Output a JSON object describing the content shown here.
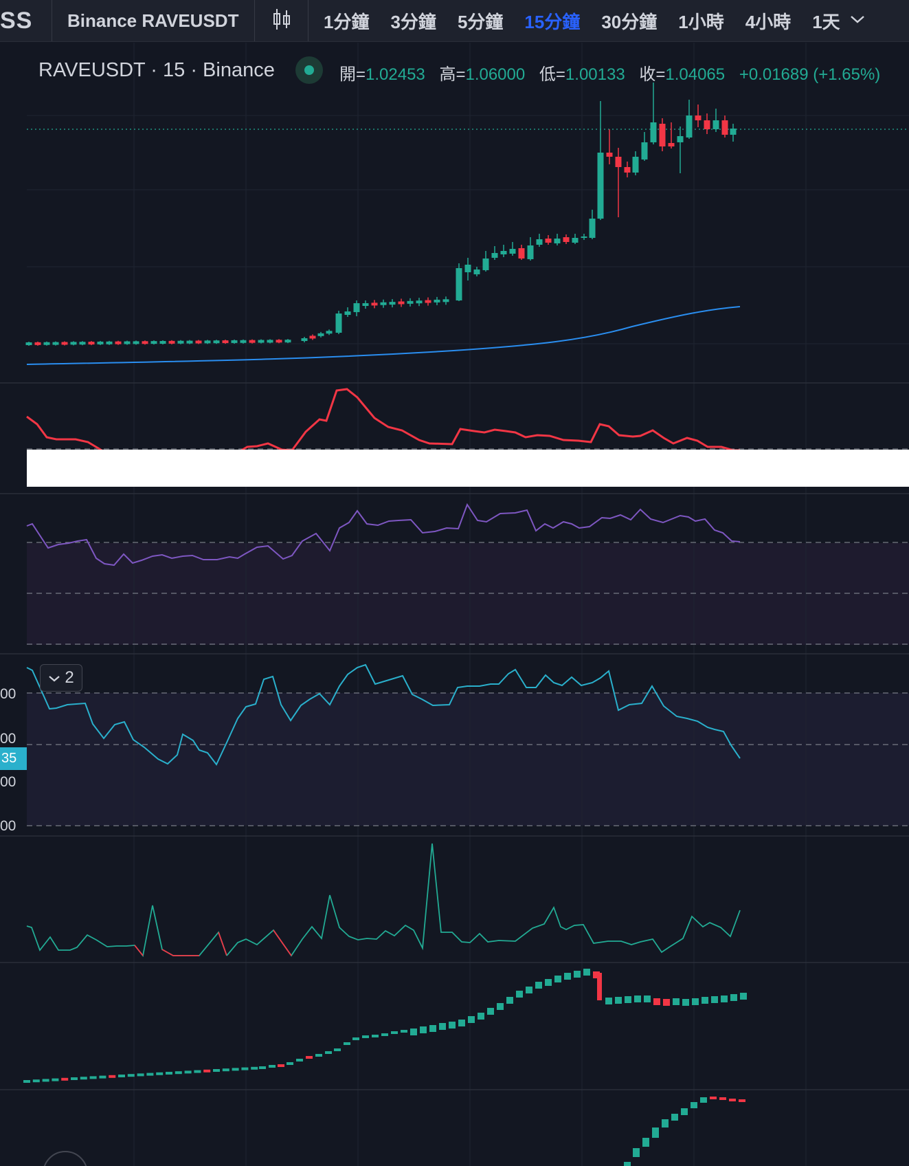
{
  "toolbar": {
    "logo_fragment": "SS",
    "symbol": "Binance RAVEUSDT",
    "chart_type_icon": "candlestick-icon",
    "intervals": [
      {
        "label": "1分鐘",
        "active": false
      },
      {
        "label": "3分鐘",
        "active": false
      },
      {
        "label": "5分鐘",
        "active": false
      },
      {
        "label": "15分鐘",
        "active": true
      },
      {
        "label": "30分鐘",
        "active": false
      },
      {
        "label": "1小時",
        "active": false
      },
      {
        "label": "4小時",
        "active": false
      },
      {
        "label": "1天",
        "active": false
      }
    ],
    "more_icon": "chevron-down-icon"
  },
  "legend": {
    "title": "RAVEUSDT · 15 · Binance",
    "status_color": "#22ab94",
    "open_label": "開=",
    "open": "1.02453",
    "high_label": "高=",
    "high": "1.06000",
    "low_label": "低=",
    "low": "1.00133",
    "close_label": "收=",
    "close": "1.04065",
    "change": "+0.01689 (+1.65%)"
  },
  "pane4": {
    "axis_labels": [
      "00",
      "00",
      "00",
      "00"
    ],
    "price_tag": "35",
    "collapse_count": "2"
  },
  "colors": {
    "up": "#22ab94",
    "down": "#f23645",
    "background": "#131722",
    "ma_line": "#2962ff",
    "rsi_line": "#7e57c2",
    "cyan_line": "#2ab0cc",
    "red_line": "#f23645"
  }
}
